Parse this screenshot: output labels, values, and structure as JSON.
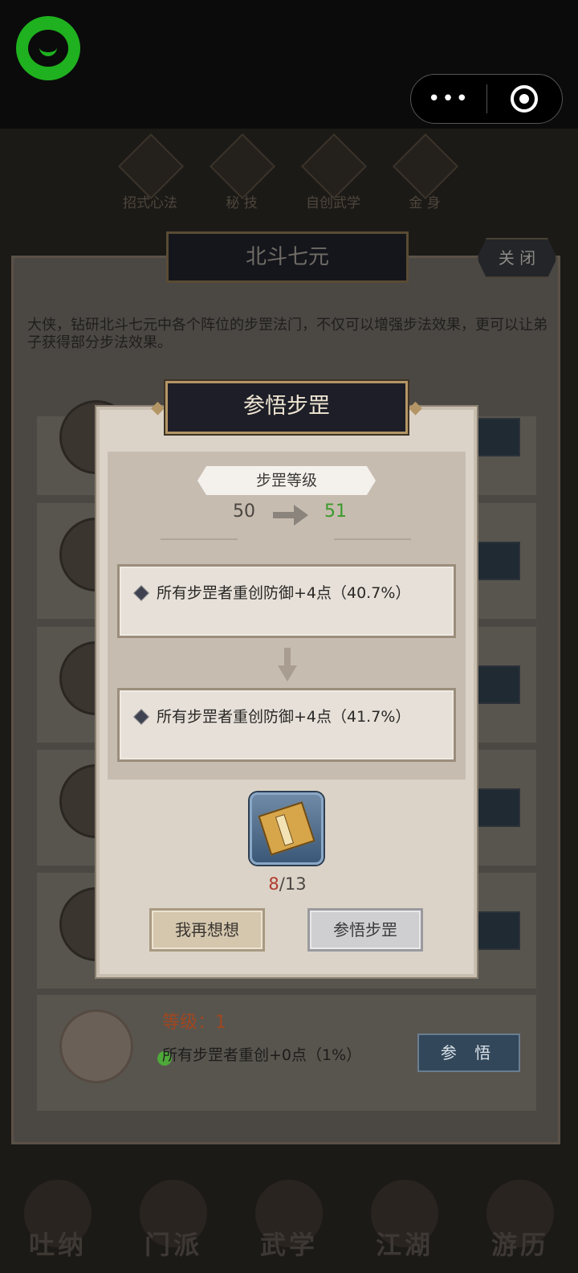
{
  "system": {
    "capsule_menu": "•••",
    "capsule_target": "target-icon"
  },
  "top_tabs": [
    "招式心法",
    "秘 技",
    "自创武学",
    "金 身"
  ],
  "panel": {
    "title": "北斗七元",
    "close_label": "关 闭",
    "intro": "大侠，钻研北斗七元中各个阵位的步罡法门，不仅可以增强步法效果，更可以让弟子获得部分步法效果。",
    "row_button": "参悟",
    "partial_button": "悟",
    "last_row": {
      "level_label": "等级：1",
      "desc": "所有步罡者重创+0点（1%）",
      "button": "参 悟"
    }
  },
  "modal": {
    "title": "参悟步罡",
    "level_label": "步罡等级",
    "level_from": "50",
    "level_to": "51",
    "current_effect": "所有步罡者重创防御+4点（40.7%）",
    "next_effect": "所有步罡者重创防御+4点（41.7%）",
    "cost_have": "8",
    "cost_need": "/13",
    "cancel_label": "我再想想",
    "confirm_label": "参悟步罡"
  },
  "bottom_nav": [
    "吐纳",
    "门派",
    "武学",
    "江湖",
    "游历"
  ],
  "colors": {
    "accent_gold": "#b49666",
    "level_up_green": "#3c9a2c",
    "cost_red": "#b03a2e",
    "logo_green": "#1fb11f"
  }
}
